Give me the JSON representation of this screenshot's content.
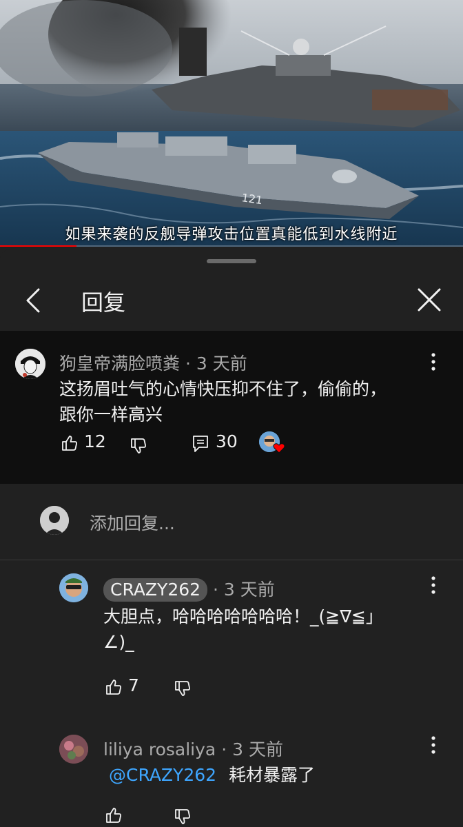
{
  "video": {
    "subtitle": "如果来袭的反舰导弹攻击位置真能低到水线附近",
    "hull_number": "121",
    "progress_fraction": 0.165,
    "progress_color": "#ff0000"
  },
  "panel": {
    "title": "回复"
  },
  "top_comment": {
    "author": "狗皇帝满脸喷粪",
    "time": "3 天前",
    "text_line1": "这扬眉吐气的心情快压抑不住了，偷偷的，",
    "text_line2": "跟你一样高兴",
    "likes": "12",
    "replies": "30"
  },
  "add_reply": {
    "placeholder": "添加回复..."
  },
  "replies": [
    {
      "author": "CRAZY262",
      "time": "3 天前",
      "text_line1": "大胆点，哈哈哈哈哈哈哈！_(≧∇≦」",
      "text_line2": "∠)_",
      "likes": "7"
    },
    {
      "author": "liliya rosaliya",
      "time": "3 天前",
      "mention": "@CRAZY262",
      "text": "耗材暴露了"
    }
  ],
  "colors": {
    "background": "#212121",
    "highlight_background": "#0f0f0f",
    "secondary_text": "#aaaaaa",
    "mention": "#3ea6ff",
    "heart": "#ff0000"
  }
}
